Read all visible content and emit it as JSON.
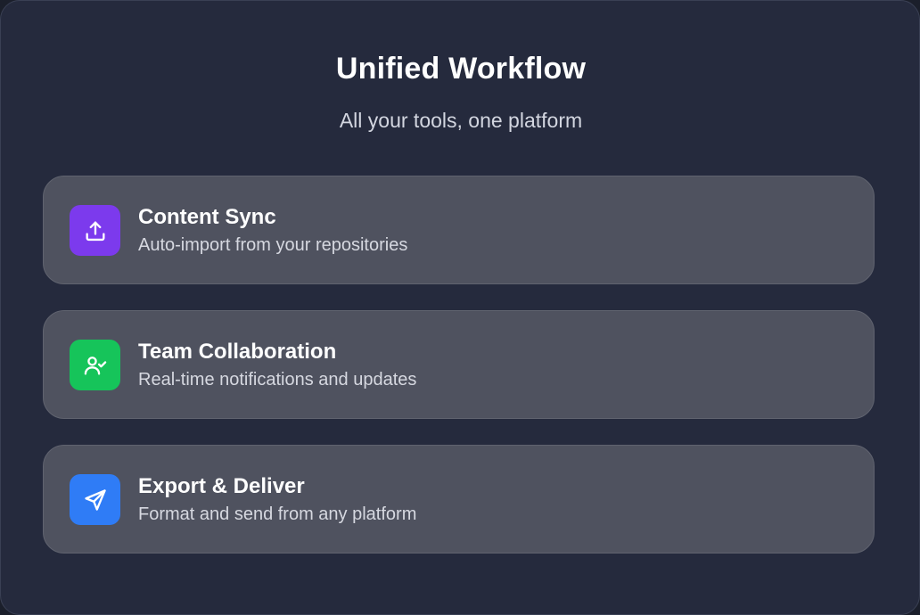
{
  "header": {
    "title": "Unified Workflow",
    "subtitle": "All your tools, one platform"
  },
  "features": [
    {
      "title": "Content Sync",
      "description": "Auto-import from your repositories",
      "icon": "upload-icon",
      "color": "#7c3aed"
    },
    {
      "title": "Team Collaboration",
      "description": "Real-time notifications and updates",
      "icon": "user-check-icon",
      "color": "#16c45a"
    },
    {
      "title": "Export & Deliver",
      "description": "Format and send from any platform",
      "icon": "send-icon",
      "color": "#2f7cf6"
    }
  ]
}
